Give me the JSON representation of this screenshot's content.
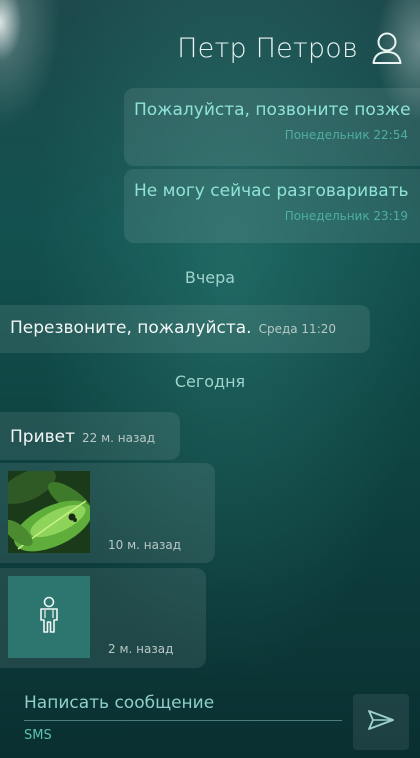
{
  "header": {
    "title": "Петр Петров",
    "icon": "person-icon"
  },
  "messages": [
    {
      "direction": "outgoing",
      "text": "Пожалуйста, позвоните позже",
      "time": "Понедельник 22:54"
    },
    {
      "direction": "outgoing",
      "text": "Не могу сейчас разговаривать",
      "time": "Понедельник 23:19"
    },
    {
      "type": "date-separator",
      "label": "Вчера"
    },
    {
      "direction": "incoming",
      "text": "Перезвоните, пожалуйста.",
      "time": "Среда 11:20"
    },
    {
      "type": "date-separator",
      "label": "Сегодня"
    },
    {
      "direction": "incoming",
      "text": "Привет",
      "time": "22 м. назад"
    },
    {
      "direction": "incoming",
      "attachment": "photo",
      "time": "10 м. назад"
    },
    {
      "direction": "incoming",
      "attachment": "contact-card",
      "icon": "contact-person-icon",
      "time": "2 м. назад"
    }
  ],
  "compose": {
    "placeholder": "Написать сообщение",
    "channel": "SMS",
    "send_icon": "send-icon"
  },
  "colors": {
    "accent": "#8fe3d6",
    "background_top": "#1d4a4c",
    "background_bottom": "#0a2f31"
  }
}
